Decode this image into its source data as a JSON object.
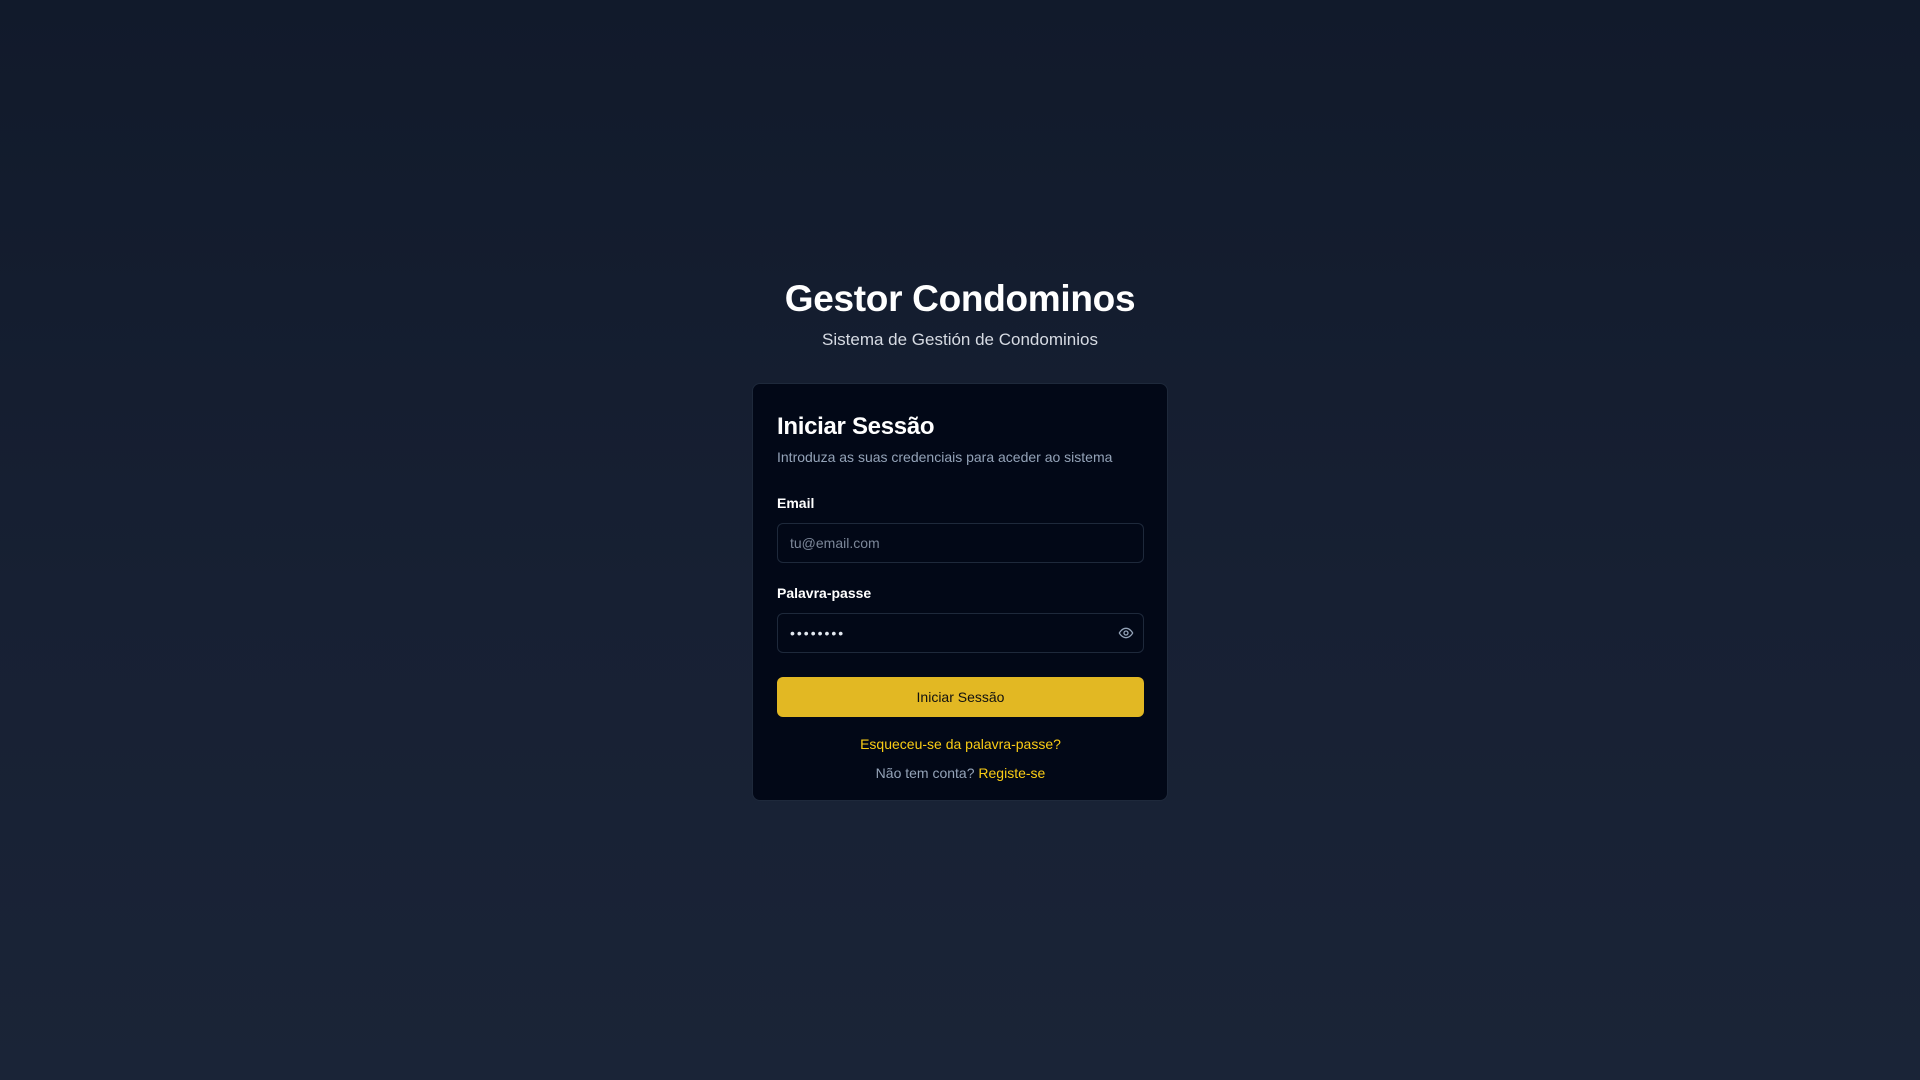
{
  "brand": {
    "title": "Gestor Condominos",
    "subtitle": "Sistema de Gestión de Condominios"
  },
  "login_card": {
    "title": "Iniciar Sessão",
    "description": "Introduza as suas credenciais para aceder ao sistema",
    "email": {
      "label": "Email",
      "placeholder": "tu@email.com",
      "value": ""
    },
    "password": {
      "label": "Palavra-passe",
      "value": "password",
      "toggle_icon": "eye-icon"
    },
    "submit_label": "Iniciar Sessão",
    "forgot_password_label": "Esqueceu-se da palavra-passe?",
    "signup_prompt": "Não tem conta?",
    "signup_label": "Registe-se"
  },
  "colors": {
    "accent": "#e2b823",
    "link": "#facc15",
    "card_background": "#020817",
    "page_background": "#172033"
  }
}
